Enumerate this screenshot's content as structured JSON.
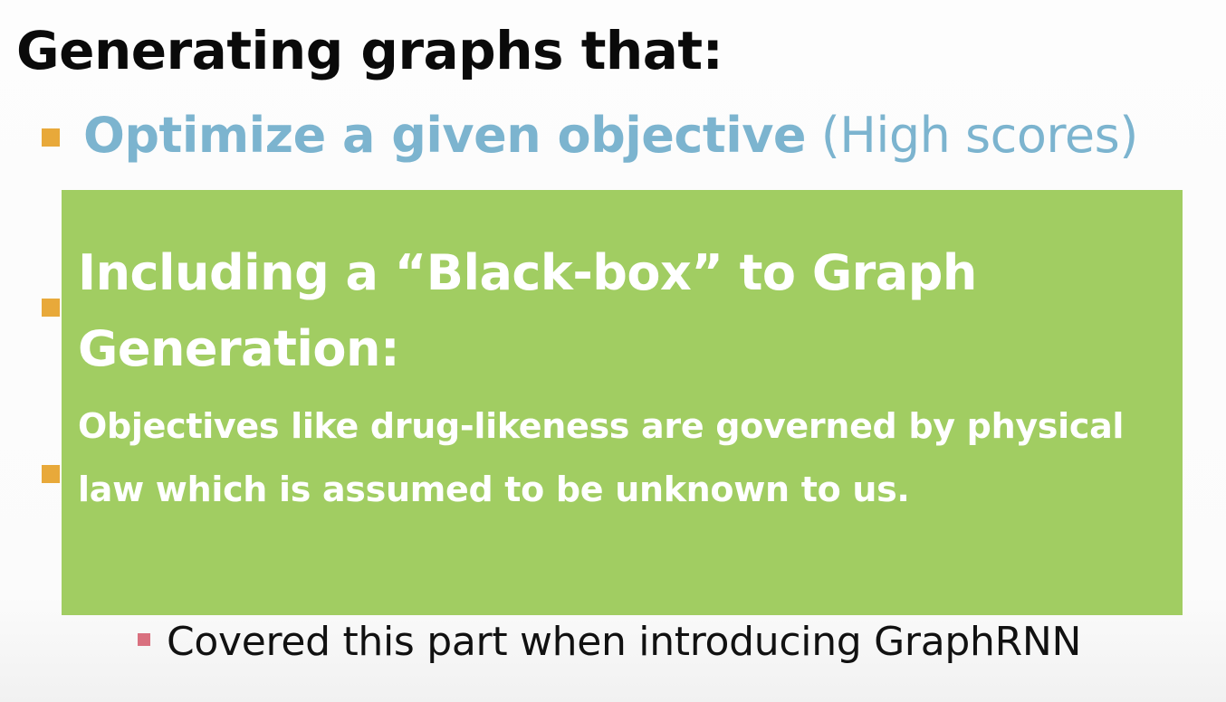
{
  "slide": {
    "title": "Generating graphs that:",
    "bullet1": {
      "bold_text": "Optimize a given objective",
      "normal_text": " (High scores)"
    },
    "overlay": {
      "heading": "Including a “Black-box” to Graph Generation:",
      "body": "Objectives like drug-likeness are governed by physical law which is assumed to be unknown to us."
    },
    "sub_bullet": "Covered this part when introducing GraphRNN"
  },
  "colors": {
    "bullet_square": "#e8a93a",
    "sub_bullet_square": "#d9707f",
    "bullet1_text": "#7cb4cf",
    "overlay_background": "#a1cd62",
    "overlay_text": "#ffffff",
    "title_text": "#0a0a0a"
  }
}
